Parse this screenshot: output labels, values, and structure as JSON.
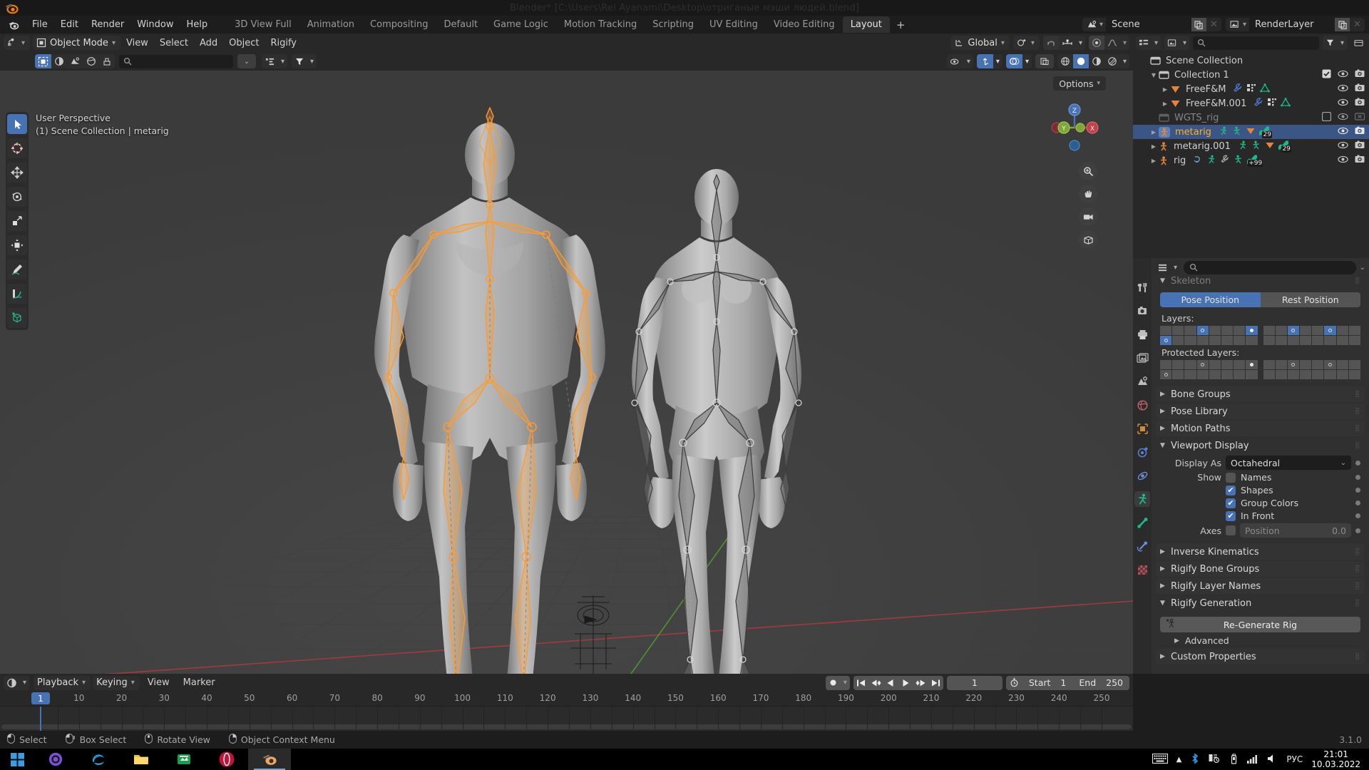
{
  "window": {
    "title": "Blender* [C:\\Users\\Rei Ayanami\\Desktop\\отриганые мэши людей.blend]"
  },
  "topbar": {
    "menus": [
      "File",
      "Edit",
      "Render",
      "Window",
      "Help"
    ],
    "workspaces": [
      {
        "label": "3D View Full",
        "active": false
      },
      {
        "label": "Animation",
        "active": false
      },
      {
        "label": "Compositing",
        "active": false
      },
      {
        "label": "Default",
        "active": false
      },
      {
        "label": "Game Logic",
        "active": false
      },
      {
        "label": "Motion Tracking",
        "active": false
      },
      {
        "label": "Scripting",
        "active": false
      },
      {
        "label": "UV Editing",
        "active": false
      },
      {
        "label": "Video Editing",
        "active": false
      },
      {
        "label": "Layout",
        "active": true
      }
    ],
    "add_workspace_label": "+",
    "scene": {
      "icon": "scene-icon",
      "name": "Scene",
      "new_label": "new-scene-icon",
      "unlink_label": "x"
    },
    "view_layer": {
      "icon": "viewlayer-icon",
      "name": "RenderLayer",
      "new_label": "new-layer-icon",
      "unlink_label": "x"
    }
  },
  "viewport": {
    "mode": "Object Mode",
    "menus": [
      "View",
      "Select",
      "Add",
      "Object",
      "Rigify"
    ],
    "transform_orientation": "Global",
    "options_label": "Options",
    "overlay_line1": "User Perspective",
    "overlay_line2": "(1) Scene Collection | metarig",
    "gizmo_axes": [
      "Z",
      "X",
      "Y"
    ],
    "tools": [
      {
        "name": "tweak-tool",
        "active": true
      },
      {
        "name": "cursor-tool",
        "active": false
      },
      {
        "name": "move-tool",
        "active": false
      },
      {
        "name": "rotate-tool",
        "active": false
      },
      {
        "name": "scale-tool",
        "active": false
      },
      {
        "name": "transform-tool",
        "active": false
      },
      {
        "name": "annotate-tool",
        "active": false
      },
      {
        "name": "measure-tool",
        "active": false
      },
      {
        "name": "add-cube-tool",
        "active": false
      }
    ]
  },
  "outliner": {
    "search_placeholder": "",
    "rows": [
      {
        "label": "Scene Collection",
        "icon": "collection-icon",
        "indent": 0,
        "disclosure": "",
        "selected": false,
        "dim": false,
        "icons": [],
        "right": []
      },
      {
        "label": "Collection 1",
        "icon": "collection-icon",
        "indent": 1,
        "disclosure": "down",
        "selected": false,
        "dim": false,
        "icons": [],
        "right": [
          "checkbox-on",
          "eye-icon",
          "camera-icon"
        ]
      },
      {
        "label": "FreeF&M",
        "icon": "mesh-data-icon",
        "indent": 2,
        "disclosure": "right",
        "selected": false,
        "dim": false,
        "icons": [
          "wrench-icon",
          "modifier-icon",
          "mesh-icon"
        ],
        "right": [
          "eye-icon",
          "camera-icon"
        ]
      },
      {
        "label": "FreeF&M.001",
        "icon": "mesh-data-icon",
        "indent": 2,
        "disclosure": "right",
        "selected": false,
        "dim": false,
        "icons": [
          "wrench-icon",
          "modifier-icon",
          "mesh-icon"
        ],
        "right": [
          "eye-icon",
          "camera-icon"
        ]
      },
      {
        "label": "WGTS_rig",
        "icon": "collection-icon",
        "indent": 1,
        "disclosure": "",
        "selected": false,
        "dim": true,
        "icons": [],
        "right": [
          "checkbox-off",
          "eye-icon",
          "camera-off-icon"
        ]
      },
      {
        "label": "metarig",
        "icon": "armature-icon",
        "indent": 1,
        "disclosure": "right",
        "selected": true,
        "dim": false,
        "icons": [
          "pose-icon",
          "pose-icon",
          "mesh-data-icon",
          "bone-icon"
        ],
        "badge": "29",
        "right": [
          "eye-icon",
          "camera-icon"
        ]
      },
      {
        "label": "metarig.001",
        "icon": "armature-icon",
        "indent": 1,
        "disclosure": "right",
        "selected": false,
        "dim": false,
        "icons": [
          "pose-icon",
          "pose-icon",
          "mesh-data-icon",
          "bone-icon"
        ],
        "badge": "29",
        "right": [
          "eye-icon",
          "camera-icon"
        ]
      },
      {
        "label": "rig",
        "icon": "armature-icon",
        "indent": 1,
        "disclosure": "right",
        "selected": false,
        "dim": false,
        "icons": [
          "anim-icon",
          "pose-icon",
          "wrench-icon",
          "pose-icon",
          "bone-icon"
        ],
        "badge": "+99",
        "right": [
          "eye-icon",
          "camera-icon"
        ]
      }
    ]
  },
  "properties": {
    "search_placeholder": "",
    "tabs": [
      {
        "name": "tool-tab",
        "active": false
      },
      {
        "name": "render-tab",
        "active": false
      },
      {
        "name": "output-tab",
        "active": false
      },
      {
        "name": "viewlayer-tab",
        "active": false
      },
      {
        "name": "scene-tab",
        "active": false
      },
      {
        "name": "world-tab",
        "active": false
      },
      {
        "name": "object-tab",
        "active": false
      },
      {
        "name": "modifier-tab",
        "active": false
      },
      {
        "name": "physics-tab",
        "active": false
      },
      {
        "name": "object-data-tab",
        "active": true
      },
      {
        "name": "bone-tab",
        "active": false
      },
      {
        "name": "bone-constraint-tab",
        "active": false
      },
      {
        "name": "texture-tab",
        "active": false
      }
    ],
    "skeleton": {
      "title": "Skeleton",
      "pose_position_label": "Pose Position",
      "rest_position_label": "Rest Position",
      "pose_position_active": true,
      "layers_label": "Layers:",
      "protected_layers_label": "Protected Layers:",
      "layers": {
        "left_top": [
          0,
          0,
          0,
          1,
          0,
          0,
          0,
          2
        ],
        "left_bottom": [
          1,
          0,
          0,
          0,
          0,
          0,
          0,
          0
        ],
        "right_top": [
          0,
          0,
          1,
          0,
          0,
          1,
          0,
          0
        ],
        "right_bottom": [
          0,
          0,
          0,
          0,
          0,
          0,
          0,
          0
        ]
      },
      "protected": {
        "left_top": [
          0,
          0,
          0,
          3,
          0,
          0,
          0,
          4
        ],
        "left_bottom": [
          3,
          0,
          0,
          0,
          0,
          0,
          0,
          0
        ],
        "right_top": [
          0,
          0,
          3,
          0,
          0,
          3,
          0,
          0
        ],
        "right_bottom": [
          0,
          0,
          0,
          0,
          0,
          0,
          0,
          0
        ]
      }
    },
    "panels": [
      {
        "label": "Bone Groups",
        "open": false
      },
      {
        "label": "Pose Library",
        "open": false
      },
      {
        "label": "Motion Paths",
        "open": false
      }
    ],
    "viewport_display": {
      "title": "Viewport Display",
      "display_as_label": "Display As",
      "display_as_value": "Octahedral",
      "show_label": "Show",
      "checks": [
        {
          "label": "Names",
          "checked": false
        },
        {
          "label": "Shapes",
          "checked": true
        },
        {
          "label": "Group Colors",
          "checked": true
        },
        {
          "label": "In Front",
          "checked": true
        }
      ],
      "axes_label": "Axes",
      "axes_checked": false,
      "position_placeholder": "Position",
      "position_value": "0.0"
    },
    "panels_lower": [
      {
        "label": "Inverse Kinematics",
        "open": false
      },
      {
        "label": "Rigify Bone Groups",
        "open": false
      },
      {
        "label": "Rigify Layer Names",
        "open": false
      }
    ],
    "rigify_generation": {
      "title": "Rigify Generation",
      "button_label": "Re-Generate Rig",
      "advanced_label": "Advanced"
    },
    "custom_properties": {
      "label": "Custom Properties",
      "open": false
    }
  },
  "timeline": {
    "menus": [
      "Playback",
      "Keying",
      "View",
      "Marker"
    ],
    "current_frame": "1",
    "start_label": "Start",
    "start_value": "1",
    "end_label": "End",
    "end_value": "250",
    "ticks": [
      10,
      20,
      30,
      40,
      50,
      60,
      70,
      80,
      90,
      100,
      110,
      120,
      130,
      140,
      150,
      160,
      170,
      180,
      190,
      200,
      210,
      220,
      230,
      240,
      250
    ],
    "playhead_frame": 1
  },
  "statusbar": {
    "items": [
      {
        "icon": "mouse-left-icon",
        "label": "Select"
      },
      {
        "icon": "mouse-left-drag-icon",
        "label": "Box Select"
      },
      {
        "icon": "mouse-middle-icon",
        "label": "Rotate View"
      },
      {
        "icon": "mouse-right-icon",
        "label": "Object Context Menu"
      }
    ],
    "version": "3.1.0"
  },
  "taskbar": {
    "apps": [
      {
        "name": "start-button"
      },
      {
        "name": "cortana-icon"
      },
      {
        "name": "edge-icon"
      },
      {
        "name": "explorer-icon"
      },
      {
        "name": "store-icon"
      },
      {
        "name": "opera-icon"
      },
      {
        "name": "blender-icon"
      }
    ],
    "tray": [
      "keyboard-icon",
      "show-hidden-icon",
      "bluetooth-icon",
      "network-share-icon",
      "usb-icon",
      "signal-icon",
      "volume-icon"
    ],
    "language": "РУС",
    "time": "21:01",
    "date": "10.03.2022"
  },
  "colors": {
    "accent_blue": "#4772b3",
    "selected_orange": "#ffaf29",
    "armature_green": "#1fb98b",
    "mesh_orange": "#e8843a",
    "bg_dark": "#1d1d1d",
    "bg_panel": "#303030",
    "viewport_bg": "#3b3b3b"
  }
}
